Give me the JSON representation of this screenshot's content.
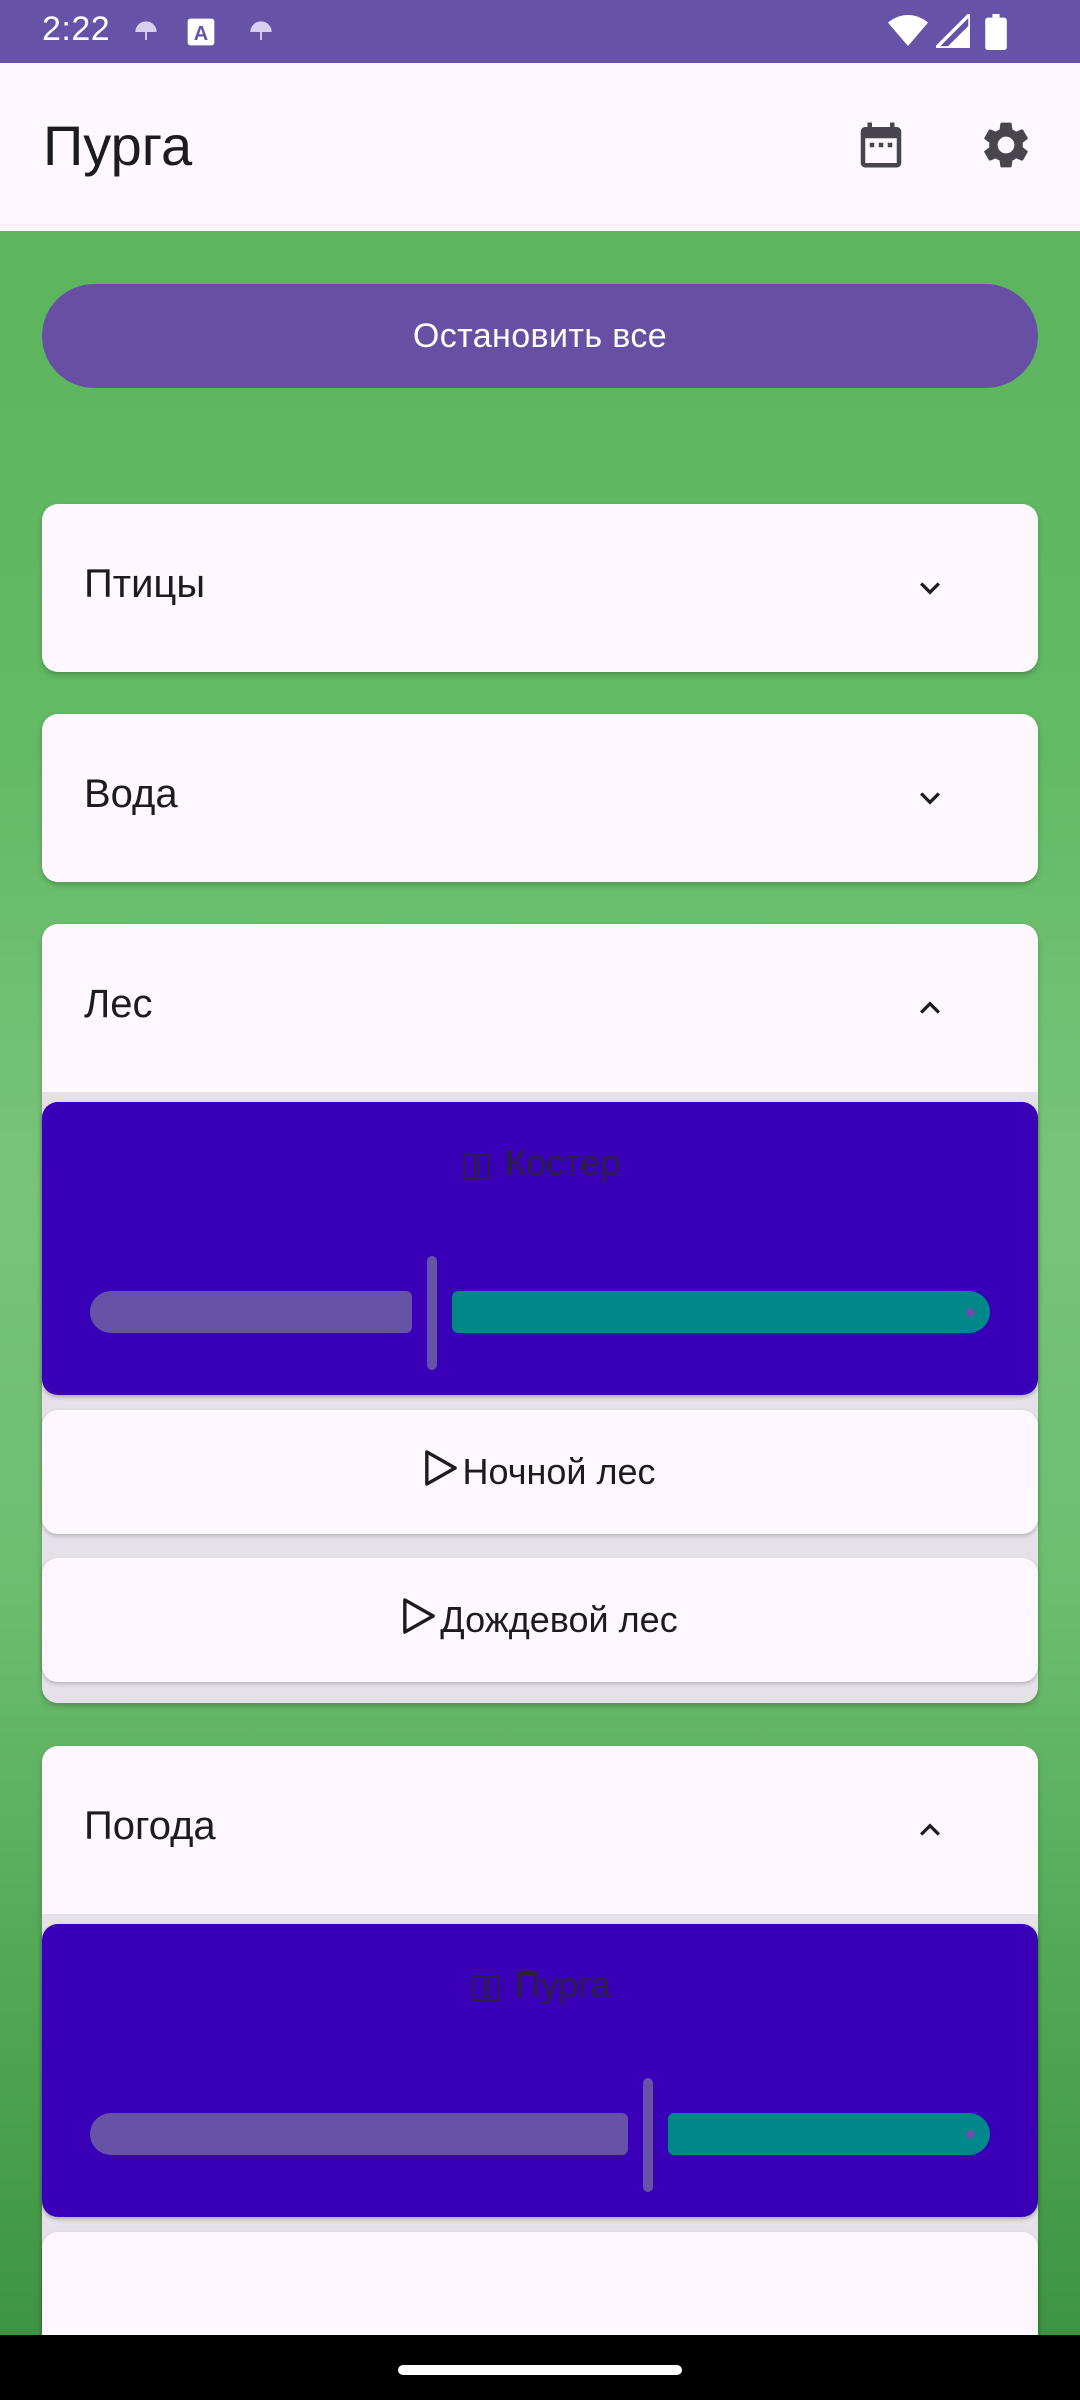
{
  "status_bar": {
    "time": "2:22",
    "icons": [
      "umbrella-icon",
      "text-a-icon",
      "umbrella-icon",
      "wifi-icon",
      "cellular-icon",
      "battery-icon"
    ]
  },
  "app_bar": {
    "title": "Пурга",
    "actions": [
      "calendar-icon",
      "settings-icon"
    ]
  },
  "stop_all_label": "Остановить все",
  "sections": [
    {
      "title": "Птицы",
      "expanded": false,
      "chevron": "chevron-down-icon"
    },
    {
      "title": "Вода",
      "expanded": false,
      "chevron": "chevron-down-icon"
    },
    {
      "title": "Лес",
      "expanded": true,
      "chevron": "chevron-up-icon",
      "playing": {
        "label": "Костер",
        "icon": "pause-icon",
        "volume": 0.38
      },
      "items": [
        {
          "label": "Ночной лес",
          "icon": "play-icon"
        },
        {
          "label": "Дождевой лес",
          "icon": "play-icon"
        }
      ]
    },
    {
      "title": "Погода",
      "expanded": true,
      "chevron": "chevron-up-icon",
      "playing": {
        "label": "Пурга",
        "icon": "pause-icon",
        "volume": 0.62
      }
    }
  ],
  "colors": {
    "status_bar": "#6652A6",
    "primary": "#6750A4",
    "surface": "#FEF7FF",
    "playing_card": "#3A00B8",
    "slider_inactive": "#00878A",
    "background_green": "#5CB65E"
  }
}
